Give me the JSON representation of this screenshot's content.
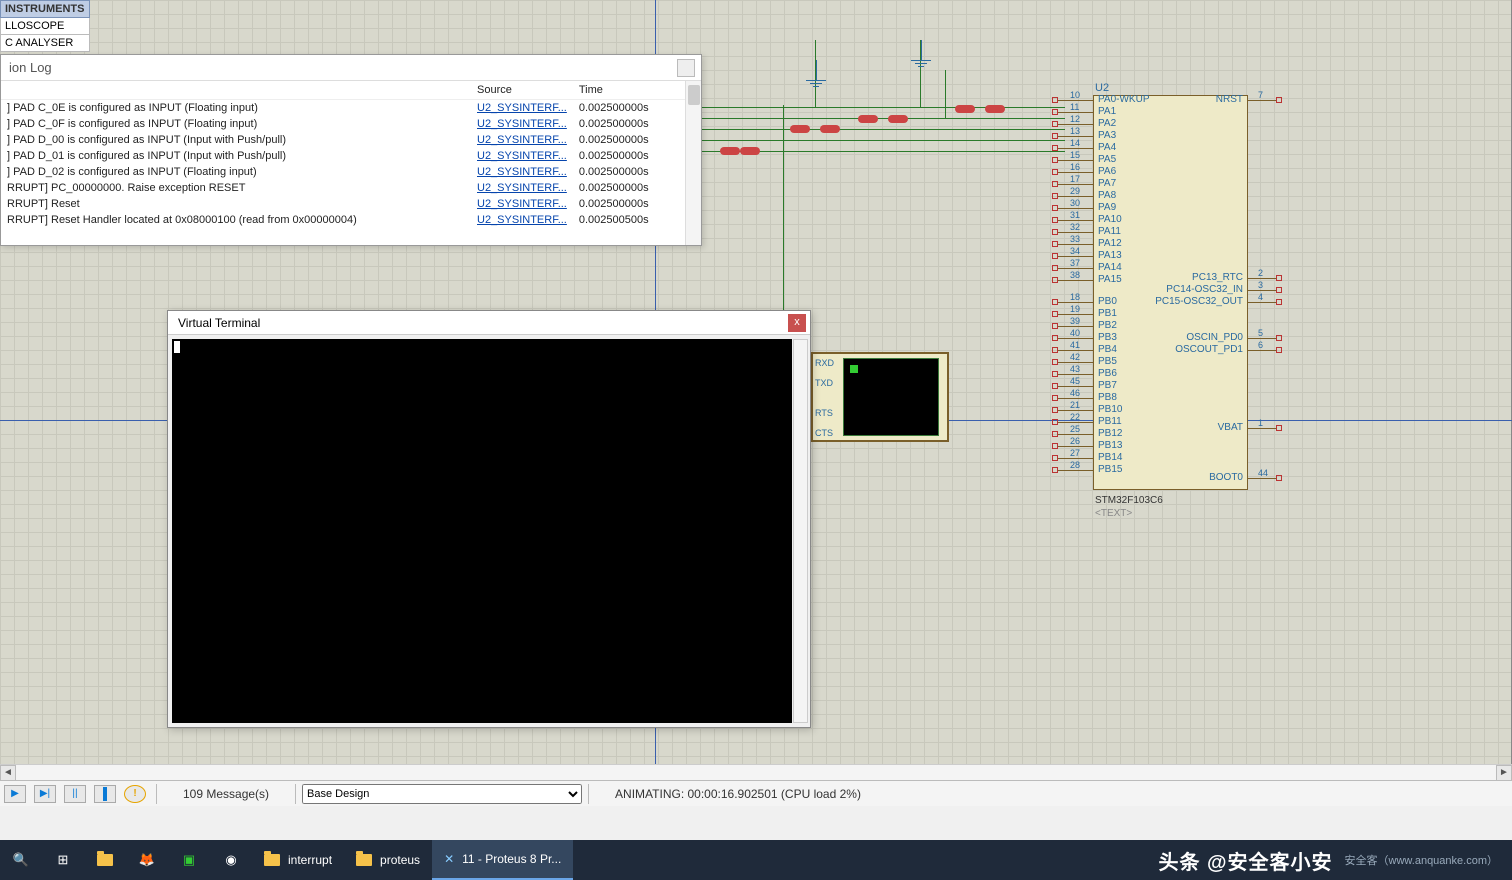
{
  "sidepanel": {
    "header": "INSTRUMENTS",
    "row1": "LLOSCOPE",
    "row2": "C ANALYSER"
  },
  "log": {
    "title": "ion Log",
    "col_source": "Source",
    "col_time": "Time",
    "rows": [
      {
        "msg": "] PAD C_0E is configured as INPUT (Floating input)",
        "src": "U2_SYSINTERF...",
        "t": "0.002500000s"
      },
      {
        "msg": "] PAD C_0F is configured as INPUT (Floating input)",
        "src": "U2_SYSINTERF...",
        "t": "0.002500000s"
      },
      {
        "msg": "] PAD D_00 is configured as INPUT (Input with Push/pull)",
        "src": "U2_SYSINTERF...",
        "t": "0.002500000s"
      },
      {
        "msg": "] PAD D_01 is configured as INPUT (Input with Push/pull)",
        "src": "U2_SYSINTERF...",
        "t": "0.002500000s"
      },
      {
        "msg": "] PAD D_02 is configured as INPUT (Floating input)",
        "src": "U2_SYSINTERF...",
        "t": "0.002500000s"
      },
      {
        "msg": "RRUPT] PC_00000000. Raise exception RESET",
        "src": "U2_SYSINTERF...",
        "t": "0.002500000s"
      },
      {
        "msg": "RRUPT] Reset",
        "src": "U2_SYSINTERF...",
        "t": "0.002500000s"
      },
      {
        "msg": "RRUPT] Reset Handler located at 0x08000100 (read from 0x00000004)",
        "src": "U2_SYSINTERF...",
        "t": "0.002500500s"
      }
    ]
  },
  "vterm": {
    "title": "Virtual Terminal",
    "close": "x"
  },
  "chip": {
    "ref": "U2",
    "part": "STM32F103C6",
    "text_placeholder": "<TEXT>",
    "left_pins": [
      {
        "n": "10",
        "l": "PA0-WKUP"
      },
      {
        "n": "11",
        "l": "PA1"
      },
      {
        "n": "12",
        "l": "PA2"
      },
      {
        "n": "13",
        "l": "PA3"
      },
      {
        "n": "14",
        "l": "PA4"
      },
      {
        "n": "15",
        "l": "PA5"
      },
      {
        "n": "16",
        "l": "PA6"
      },
      {
        "n": "17",
        "l": "PA7"
      },
      {
        "n": "29",
        "l": "PA8"
      },
      {
        "n": "30",
        "l": "PA9"
      },
      {
        "n": "31",
        "l": "PA10"
      },
      {
        "n": "32",
        "l": "PA11"
      },
      {
        "n": "33",
        "l": "PA12"
      },
      {
        "n": "34",
        "l": "PA13"
      },
      {
        "n": "37",
        "l": "PA14"
      },
      {
        "n": "38",
        "l": "PA15"
      },
      {
        "n": "18",
        "l": "PB0"
      },
      {
        "n": "19",
        "l": "PB1"
      },
      {
        "n": "39",
        "l": "PB2"
      },
      {
        "n": "40",
        "l": "PB3"
      },
      {
        "n": "41",
        "l": "PB4"
      },
      {
        "n": "42",
        "l": "PB5"
      },
      {
        "n": "43",
        "l": "PB6"
      },
      {
        "n": "45",
        "l": "PB7"
      },
      {
        "n": "46",
        "l": "PB8"
      },
      {
        "n": "21",
        "l": "PB10"
      },
      {
        "n": "22",
        "l": "PB11"
      },
      {
        "n": "25",
        "l": "PB12"
      },
      {
        "n": "26",
        "l": "PB13"
      },
      {
        "n": "27",
        "l": "PB14"
      },
      {
        "n": "28",
        "l": "PB15"
      }
    ],
    "right_pins": [
      {
        "n": "7",
        "l": "NRST"
      },
      {
        "n": "2",
        "l": "PC13_RTC"
      },
      {
        "n": "3",
        "l": "PC14-OSC32_IN"
      },
      {
        "n": "4",
        "l": "PC15-OSC32_OUT"
      },
      {
        "n": "5",
        "l": "OSCIN_PD0"
      },
      {
        "n": "6",
        "l": "OSCOUT_PD1"
      },
      {
        "n": "1",
        "l": "VBAT"
      },
      {
        "n": "44",
        "l": "BOOT0"
      }
    ]
  },
  "scope_pins": {
    "p1": "RXD",
    "p2": "TXD",
    "p3": "RTS",
    "p4": "CTS"
  },
  "status": {
    "messages": "109 Message(s)",
    "design": "Base Design",
    "anim": "ANIMATING: 00:00:16.902501 (CPU load 2%)"
  },
  "taskbar": {
    "t1": "interrupt",
    "t2": "proteus",
    "t3": "11 - Proteus 8 Pr...",
    "brand": "头条 @安全客小安",
    "sub": "安全客（www.anquanke.com）"
  }
}
